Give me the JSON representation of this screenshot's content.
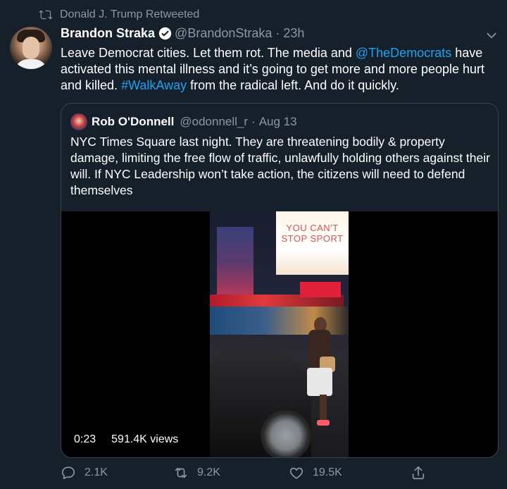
{
  "retweet_context": {
    "text": "Donald J. Trump Retweeted",
    "icon": "retweet-icon"
  },
  "tweet": {
    "display_name": "Brandon Straka",
    "verified": true,
    "handle": "@BrandonStraka",
    "separator": "·",
    "time": "23h",
    "text_parts": {
      "p1": "Leave Democrat cities. Let them rot. The media and ",
      "link1": "@TheDemocrats",
      "p2": " have activated this mental illness and it’s going to get more and more people hurt and killed. ",
      "link2": "#WalkAway",
      "p3": " from the radical left. And do it quickly."
    }
  },
  "quote": {
    "display_name": "Rob O'Donnell",
    "handle": "@odonnell_r",
    "separator": "·",
    "time": "Aug 13",
    "text": "NYC Times Square last night. They are threatening bodily & property damage, limiting the free flow of traffic, unlawfully holding others against their will. If NYC Leadership won’t take action, the citizens will need to defend themselves",
    "video": {
      "duration": "0:23",
      "views": "591.4K views",
      "billboard_text": "YOU CAN'T STOP SPORT"
    }
  },
  "actions": {
    "reply_count": "2.1K",
    "retweet_count": "9.2K",
    "like_count": "19.5K"
  },
  "colors": {
    "background": "#15202b",
    "link": "#1da1f2",
    "muted": "#8899a6",
    "border": "#38444d"
  }
}
